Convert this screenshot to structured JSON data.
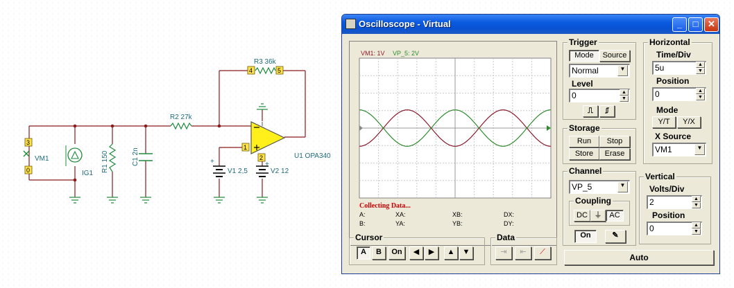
{
  "schematic": {
    "vm1_pin_top": "3",
    "vm1_pin_bottom": "0",
    "vm1_label": "VM1",
    "ig1_label": "IG1",
    "r1_label": "R1 150",
    "c1_label": "C1 2n",
    "r2_label": "R2 27k",
    "r3_label": "R3 36k",
    "r3_pin_left": "4",
    "r3_pin_right": "5",
    "v1_label": "V1 2,5",
    "v1_pin": "1",
    "v2_label": "V2 12",
    "v2_pin": "2",
    "u1_label": "U1 OPA340",
    "plus": "+"
  },
  "window": {
    "title": "Oscilloscope - Virtual",
    "minimize": "_",
    "maximize": "□",
    "close": "✕"
  },
  "screen": {
    "ch1_label": "VM1: 1V",
    "ch2_label": "VP_5: 2V",
    "ch1_color": "#8b1a2b",
    "ch2_color": "#2e8b2e",
    "status": "Collecting Data...",
    "readouts": {
      "a": "A:",
      "xa": "XA:",
      "xb": "XB:",
      "dx": "DX:",
      "b": "B:",
      "ya": "YA:",
      "yb": "YB:",
      "dy": "DY:"
    },
    "marker_a": "A",
    "marker_b": "B"
  },
  "trigger": {
    "title": "Trigger",
    "mode_btn": "Mode",
    "source_btn": "Source",
    "mode_value": "Normal",
    "level_label": "Level",
    "level_value": "0",
    "rise_icon": "rising-edge-icon",
    "fall_icon": "falling-edge-icon"
  },
  "horizontal": {
    "title": "Horizontal",
    "timediv_label": "Time/Div",
    "timediv_value": "5u",
    "position_label": "Position",
    "position_value": "0",
    "mode_label": "Mode",
    "yt_btn": "Y/T",
    "yx_btn": "Y/X",
    "xsource_label": "X Source",
    "xsource_value": "VM1"
  },
  "storage": {
    "title": "Storage",
    "run": "Run",
    "stop": "Stop",
    "store": "Store",
    "erase": "Erase"
  },
  "channel": {
    "title": "Channel",
    "value": "VP_5",
    "coupling_title": "Coupling",
    "dc": "DC",
    "gnd": "⏚",
    "ac": "AC",
    "on": "On"
  },
  "vertical": {
    "title": "Vertical",
    "voltsdiv_label": "Volts/Div",
    "voltsdiv_value": "2",
    "position_label": "Position",
    "position_value": "0"
  },
  "cursor": {
    "title": "Cursor",
    "a": "A",
    "b": "B",
    "on": "On"
  },
  "data": {
    "title": "Data"
  },
  "auto_btn": "Auto"
}
